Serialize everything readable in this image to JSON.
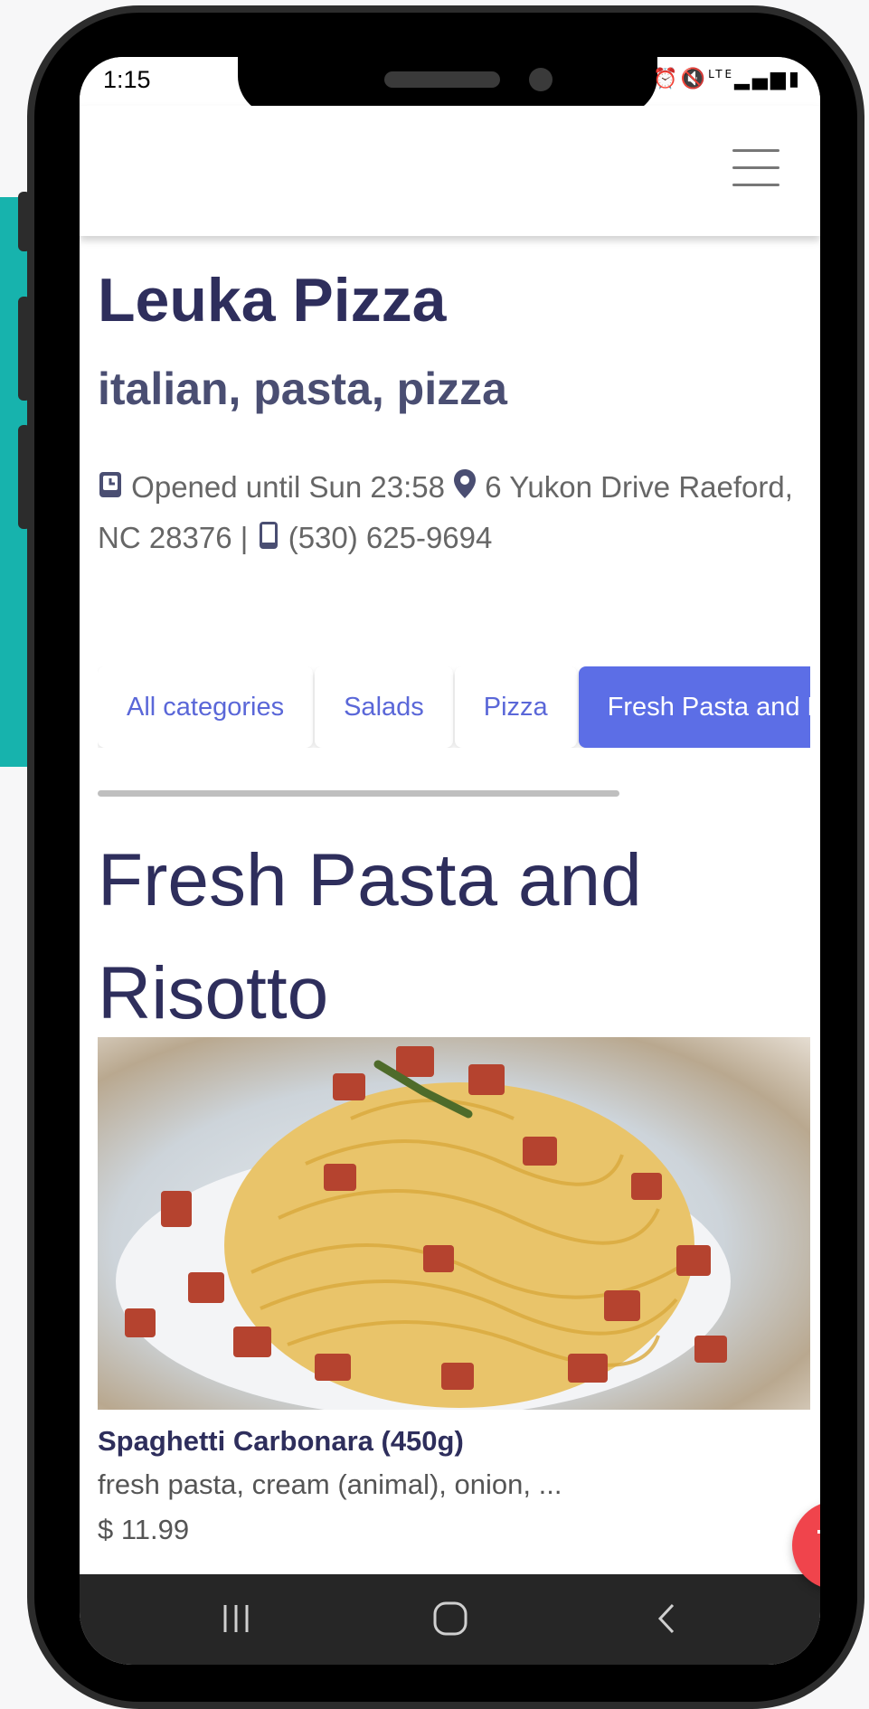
{
  "status_bar": {
    "time": "1:15",
    "icons": [
      "alarm-icon",
      "mute-icon",
      "lte-icon",
      "signal-icon",
      "battery-icon"
    ],
    "lte_label": "LTE"
  },
  "restaurant": {
    "name": "Leuka Pizza",
    "tags": "italian, pasta, pizza",
    "hours": "Opened until Sun 23:58",
    "address_line": "6 Yukon Drive Raeford, NC 28376",
    "separator": "|",
    "phone": "(530) 625-9694"
  },
  "categories": {
    "tabs": [
      {
        "label": "All categories",
        "active": false
      },
      {
        "label": "Salads",
        "active": false
      },
      {
        "label": "Pizza",
        "active": false
      },
      {
        "label": "Fresh Pasta and Risotto",
        "active": true
      }
    ]
  },
  "section": {
    "title": "Fresh Pasta and Risotto"
  },
  "menu_item": {
    "name": "Spaghetti Carbonara (450g)",
    "description": "fresh pasta, cream (animal), onion, ...",
    "price": "$ 11.99"
  },
  "colors": {
    "accent": "#5c6ee6",
    "title": "#2e2e5c",
    "cart": "#f0444c",
    "teal_background": "#17b3ad"
  }
}
